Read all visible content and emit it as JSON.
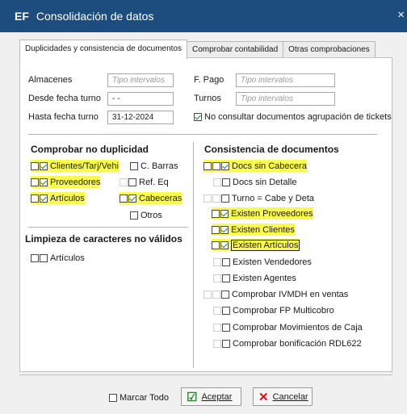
{
  "window": {
    "logo": "EF",
    "title": "Consolidación de datos",
    "close_icon": "×"
  },
  "tabs": [
    {
      "label": "Duplicidades y consistencia de documentos"
    },
    {
      "label": "Comprobar contabilidad"
    },
    {
      "label": "Otras comprobaciones"
    }
  ],
  "filters": {
    "almacenes_label": "Almacenes",
    "almacenes_placeholder": "Tipo intervalos",
    "fpago_label": "F. Pago",
    "fpago_placeholder": "Tipo intervalos",
    "desde_label": "Desde fecha turno",
    "desde_value": "- -",
    "turnos_label": "Turnos",
    "turnos_placeholder": "Tipo intervalos",
    "hasta_label": "Hasta fecha turno",
    "hasta_value": "31-12-2024",
    "no_consultar_label": "No consultar documentos agrupación de tickets"
  },
  "no_duplicidad": {
    "title": "Comprobar no duplicidad",
    "clientes": "Clientes/Tarj/Vehi",
    "c_barras": "C. Barras",
    "proveedores": "Proveedores",
    "ref_eq": "Ref. Eq",
    "articulos": "Artículos",
    "cabeceras": "Cabeceras",
    "otros": "Otros"
  },
  "limpieza": {
    "title": "Limpieza de caracteres no válidos",
    "articulos": "Artículos"
  },
  "consistencia": {
    "title": "Consistencia de documentos",
    "items": [
      "Docs sin Cabecera",
      "Docs sin Detalle",
      "Turno = Cabe y Deta",
      "Existen Proveedores",
      "Existen Clientes",
      "Existen Artículos",
      "Existen Vendedores",
      "Existen Agentes",
      "Comprobar IVMDH en ventas",
      "Comprobar FP Multicobro",
      "Comprobar Movimientos de Caja",
      "Comprobar bonificación RDL622"
    ]
  },
  "footer": {
    "marcar_todo": "Marcar Todo",
    "aceptar": "Aceptar",
    "cancelar": "Cancelar"
  },
  "colors": {
    "titlebar": "#1d4c7e",
    "highlight": "#fbfa4e",
    "check": "#2a8a2a",
    "cancel_x": "#d01818"
  }
}
